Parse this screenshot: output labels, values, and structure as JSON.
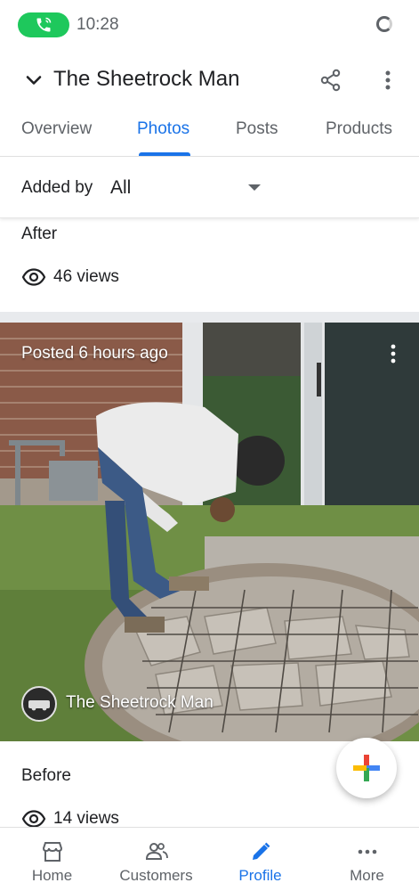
{
  "status_bar": {
    "time": "10:28",
    "call_icon": "phone-call-icon",
    "loading_icon": "loading-spinner-icon"
  },
  "header": {
    "business_name": "The Sheetrock Man",
    "back_icon": "chevron-down-icon",
    "share_icon": "share-icon",
    "menu_icon": "more-vert-icon"
  },
  "tabs": [
    {
      "label": "Overview",
      "active": false
    },
    {
      "label": "Photos",
      "active": true
    },
    {
      "label": "Posts",
      "active": false
    },
    {
      "label": "Products",
      "active": false
    }
  ],
  "filter": {
    "label": "Added by",
    "value": "All"
  },
  "photos": [
    {
      "caption": "After",
      "views": "46 views"
    },
    {
      "posted": "Posted 6 hours ago",
      "author": "The Sheetrock Man",
      "caption": "Before",
      "views": "14 views"
    }
  ],
  "fab": {
    "icon": "google-plus-icon"
  },
  "bottom_nav": [
    {
      "label": "Home",
      "icon": "storefront-icon",
      "active": false
    },
    {
      "label": "Customers",
      "icon": "people-icon",
      "active": false
    },
    {
      "label": "Profile",
      "icon": "pencil-icon",
      "active": true
    },
    {
      "label": "More",
      "icon": "more-horiz-icon",
      "active": false
    }
  ],
  "colors": {
    "accent": "#1a73e8",
    "call_green": "#1ec85c",
    "text": "#202124",
    "secondary_text": "#5f6368"
  }
}
